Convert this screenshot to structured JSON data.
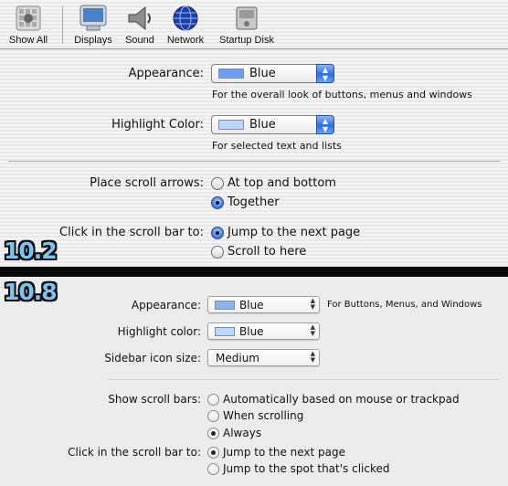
{
  "toolbar": {
    "items": [
      {
        "label": "Show All",
        "icon": "apple-grid-icon"
      },
      {
        "label": "Displays",
        "icon": "display-icon"
      },
      {
        "label": "Sound",
        "icon": "speaker-icon"
      },
      {
        "label": "Network",
        "icon": "globe-icon"
      },
      {
        "label": "Startup Disk",
        "icon": "disk-icon"
      }
    ]
  },
  "v102": {
    "version_label": "10.2",
    "appearance": {
      "label": "Appearance:",
      "value": "Blue",
      "hint": "For the overall look of buttons, menus and windows",
      "swatch": "#6f9df0"
    },
    "highlight": {
      "label": "Highlight Color:",
      "value": "Blue",
      "hint": "For selected text and lists",
      "swatch": "#bcd7fb"
    },
    "scroll_arrows": {
      "label": "Place scroll arrows:",
      "options": [
        "At top and bottom",
        "Together"
      ],
      "selected": "Together"
    },
    "scroll_click": {
      "label": "Click in the scroll bar to:",
      "options": [
        "Jump to the next page",
        "Scroll to here"
      ],
      "selected": "Jump to the next page"
    }
  },
  "v108": {
    "version_label": "10.8",
    "appearance": {
      "label": "Appearance:",
      "value": "Blue",
      "hint": "For Buttons, Menus, and Windows",
      "swatch": "#8cb4e8"
    },
    "highlight": {
      "label": "Highlight color:",
      "value": "Blue",
      "swatch": "#bcd7fb"
    },
    "sidebar": {
      "label": "Sidebar icon size:",
      "value": "Medium"
    },
    "scroll_bars": {
      "label": "Show scroll bars:",
      "options": [
        "Automatically based on mouse or trackpad",
        "When scrolling",
        "Always"
      ],
      "selected": "Always"
    },
    "scroll_click": {
      "label": "Click in the scroll bar to:",
      "options": [
        "Jump to the next page",
        "Jump to the spot that's clicked"
      ],
      "selected": "Jump to the next page"
    }
  }
}
